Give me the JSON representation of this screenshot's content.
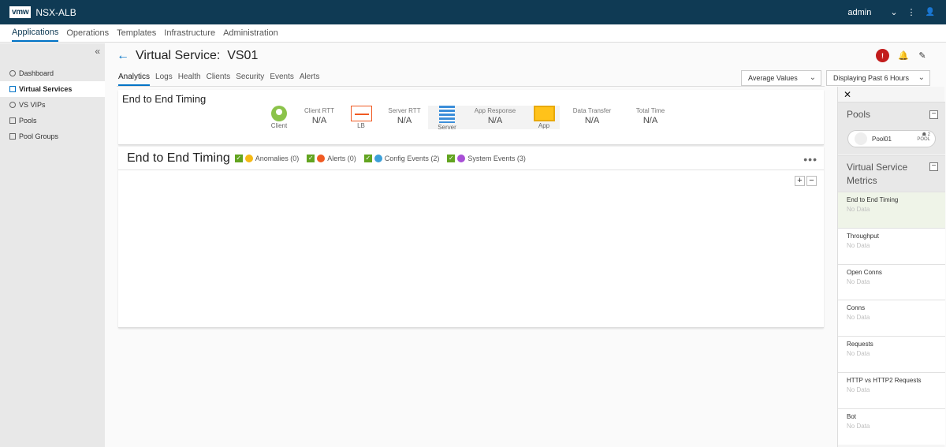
{
  "topbar": {
    "logo": "vmw",
    "app_name": "NSX-ALB",
    "user": "admin",
    "chevron": "⌄",
    "kebab": "⋮",
    "user_icon": "👤"
  },
  "mainnav": {
    "items": [
      "Applications",
      "Operations",
      "Templates",
      "Infrastructure",
      "Administration"
    ]
  },
  "sidebar": {
    "collapse": "«",
    "items": [
      "Dashboard",
      "Virtual Services",
      "VS VIPs",
      "Pools",
      "Pool Groups"
    ]
  },
  "page": {
    "back": "←",
    "title": "Virtual Service:  VS01",
    "alert_count": "!",
    "bell": "🔔",
    "pencil": "✎"
  },
  "tabs": [
    "Analytics",
    "Logs",
    "Health",
    "Clients",
    "Security",
    "Events",
    "Alerts"
  ],
  "filters": {
    "metric": "Average Values",
    "range": "Displaying Past 6 Hours"
  },
  "timing": {
    "title": "End to End Timing",
    "nodes": {
      "client": "Client",
      "lb": "LB",
      "server": "Server",
      "app": "App"
    },
    "metrics": [
      {
        "label": "Client RTT",
        "value": "N/A"
      },
      {
        "label": "Server RTT",
        "value": "N/A"
      },
      {
        "label": "App Response",
        "value": "N/A"
      },
      {
        "label": "Data Transfer",
        "value": "N/A"
      },
      {
        "label": "Total Time",
        "value": "N/A"
      }
    ]
  },
  "chart": {
    "title": "End to End Timing",
    "legend": [
      {
        "label": "Anomalies (0)",
        "color": "#f5b915"
      },
      {
        "label": "Alerts (0)",
        "color": "#f05a22"
      },
      {
        "label": "Config Events (2)",
        "color": "#3c9fd8"
      },
      {
        "label": "System Events (3)",
        "color": "#a84fd6"
      }
    ],
    "more": "•••",
    "zoom_in": "+",
    "zoom_out": "−"
  },
  "right_panel": {
    "close": "✕",
    "pools_title": "Pools",
    "pool": {
      "name": "Pool01",
      "count": "2",
      "tag": "POOL"
    },
    "metrics_title": "Virtual Service Metrics",
    "collapse": "−",
    "metric_items": [
      {
        "label": "End to End Timing",
        "sub": "No Data"
      },
      {
        "label": "Throughput",
        "sub": "No Data"
      },
      {
        "label": "Open Conns",
        "sub": "No Data"
      },
      {
        "label": "Conns",
        "sub": "No Data"
      },
      {
        "label": "Requests",
        "sub": "No Data"
      },
      {
        "label": "HTTP vs HTTP2 Requests",
        "sub": "No Data"
      },
      {
        "label": "Bot",
        "sub": "No Data"
      }
    ]
  }
}
